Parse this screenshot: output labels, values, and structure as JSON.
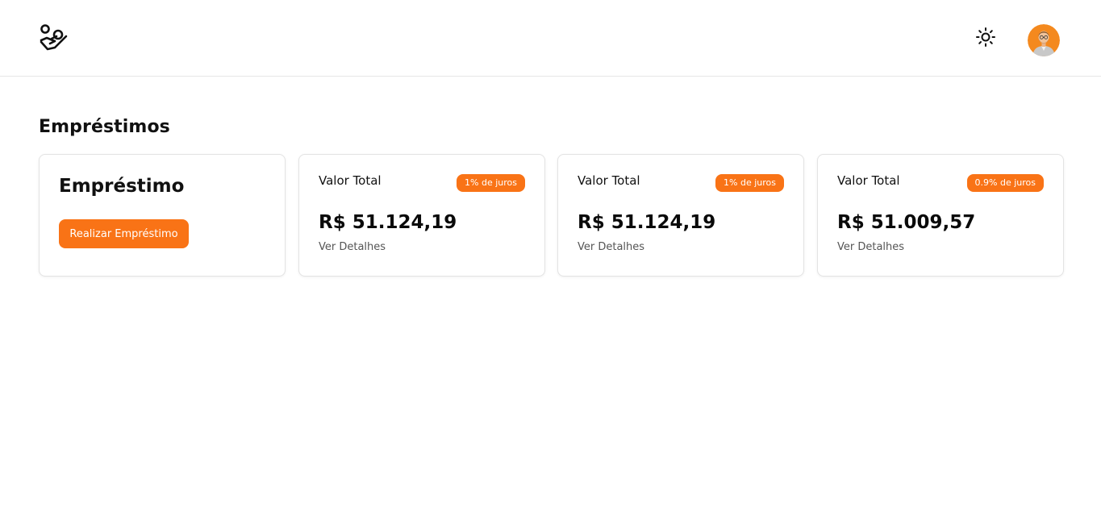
{
  "header": {
    "logo_icon": "hand-coins-icon",
    "theme_icon": "sun-icon",
    "avatar_icon": "user-avatar-icon"
  },
  "colors": {
    "accent": "#f97316",
    "text": "#111111",
    "muted": "#555555",
    "border": "#e3e3e3"
  },
  "page": {
    "title": "Empréstimos"
  },
  "new_loan": {
    "title": "Empréstimo",
    "button_label": "Realizar Empréstimo"
  },
  "loans": [
    {
      "label": "Valor Total",
      "interest": "1% de juros",
      "value": "R$ 51.124,19",
      "details": "Ver Detalhes"
    },
    {
      "label": "Valor Total",
      "interest": "1% de juros",
      "value": "R$ 51.124,19",
      "details": "Ver Detalhes"
    },
    {
      "label": "Valor Total",
      "interest": "0.9% de juros",
      "value": "R$ 51.009,57",
      "details": "Ver Detalhes"
    }
  ]
}
